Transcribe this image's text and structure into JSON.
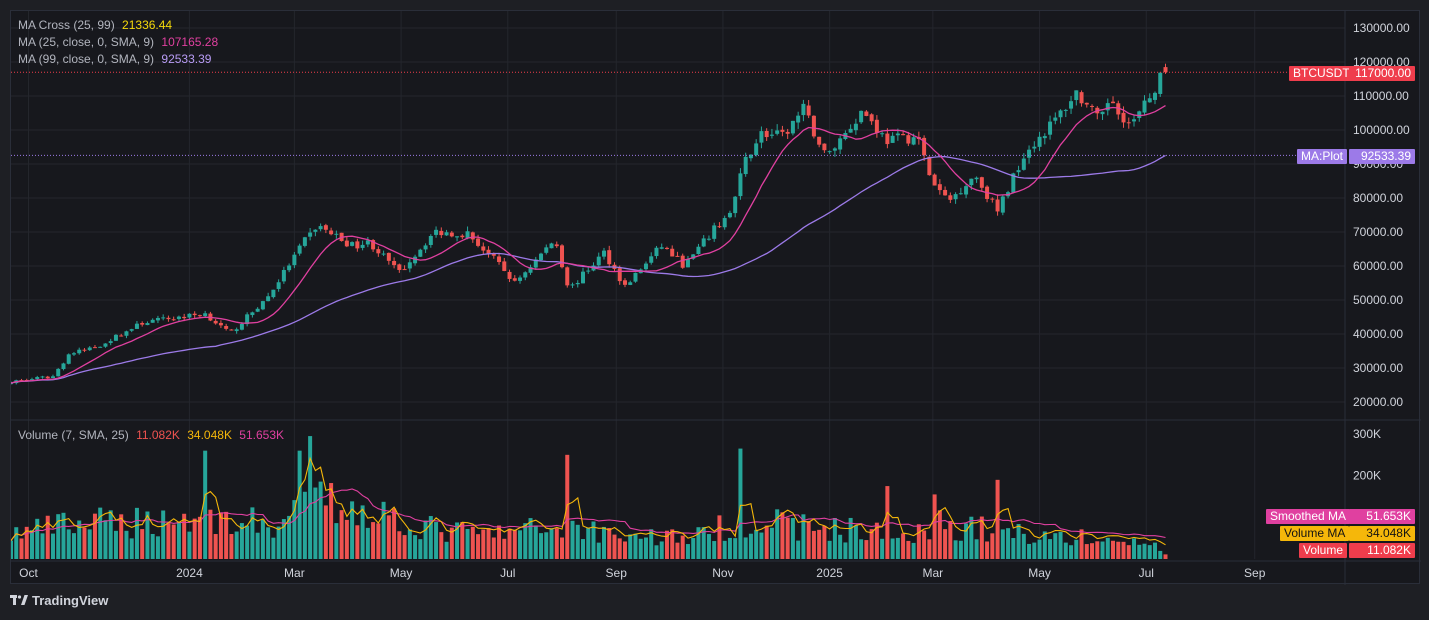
{
  "symbol_label": "BTCUSDT",
  "last_price_label": "117000.00",
  "legend": {
    "ma_cross": {
      "label": "MA Cross (25, 99)",
      "value": "21336.44"
    },
    "ma25": {
      "label": "MA (25, close, 0, SMA, 9)",
      "value": "107165.28"
    },
    "ma99": {
      "label": "MA (99, close, 0, SMA, 9)",
      "value": "92533.39"
    },
    "volume": {
      "label": "Volume (7, SMA, 25)",
      "v1": "11.082K",
      "v2": "34.048K",
      "v3": "51.653K"
    }
  },
  "badges": {
    "ma_plot_label": "MA:Plot",
    "ma_plot_value": "92533.39",
    "smoothed_label": "Smoothed MA",
    "smoothed_value": "51.653K",
    "volume_ma_label": "Volume MA",
    "volume_ma_value": "34.048K",
    "volume_label": "Volume",
    "volume_value": "11.082K"
  },
  "footer": {
    "brand": "TradingView"
  },
  "colors": {
    "up": "#26a69a",
    "down": "#ef5350",
    "ma25": "#e040a0",
    "ma99": "#9c7ae8",
    "vol_ma": "#f5b70a",
    "smoothed": "#e040a0",
    "grid": "#24262d",
    "axis_text": "#d1d4dc"
  },
  "chart_data": {
    "type": "candlestick",
    "price_axis": {
      "ticks": [
        20000,
        30000,
        40000,
        50000,
        60000,
        70000,
        80000,
        90000,
        100000,
        110000,
        120000,
        130000
      ],
      "tick_labels": [
        "20000.00",
        "30000.00",
        "40000.00",
        "50000.00",
        "60000.00",
        "70000.00",
        "80000.00",
        "90000.00",
        "100000.00",
        "110000.00",
        "120000.00",
        "130000.00"
      ],
      "range": [
        15000,
        135000
      ]
    },
    "volume_axis": {
      "ticks": [
        200000,
        300000
      ],
      "tick_labels": [
        "200K",
        "300K"
      ],
      "range": [
        0,
        310000
      ]
    },
    "x_axis": {
      "labels": [
        "Oct",
        "2024",
        "Mar",
        "May",
        "Jul",
        "Sep",
        "Nov",
        "2025",
        "Mar",
        "May",
        "Jul",
        "Sep"
      ],
      "dates": [
        "2023-10-01",
        "2024-01-01",
        "2024-03-01",
        "2024-05-01",
        "2024-07-01",
        "2024-09-01",
        "2024-11-01",
        "2025-01-01",
        "2025-03-01",
        "2025-05-01",
        "2025-07-01",
        "2025-09-01"
      ]
    },
    "price_anchors": [
      [
        "2023-09-21",
        26000
      ],
      [
        "2023-10-15",
        27500
      ],
      [
        "2023-10-24",
        34000
      ],
      [
        "2023-11-10",
        36500
      ],
      [
        "2023-12-06",
        43500
      ],
      [
        "2024-01-10",
        46000
      ],
      [
        "2024-01-24",
        40000
      ],
      [
        "2024-02-15",
        51000
      ],
      [
        "2024-03-05",
        66000
      ],
      [
        "2024-03-14",
        72000
      ],
      [
        "2024-04-03",
        66000
      ],
      [
        "2024-04-13",
        67000
      ],
      [
        "2024-04-30",
        58000
      ],
      [
        "2024-05-20",
        70000
      ],
      [
        "2024-06-08",
        69500
      ],
      [
        "2024-06-25",
        61000
      ],
      [
        "2024-07-05",
        55000
      ],
      [
        "2024-07-28",
        68000
      ],
      [
        "2024-08-05",
        53000
      ],
      [
        "2024-08-25",
        64000
      ],
      [
        "2024-09-06",
        54000
      ],
      [
        "2024-09-27",
        66000
      ],
      [
        "2024-10-10",
        60000
      ],
      [
        "2024-10-29",
        72000
      ],
      [
        "2024-11-06",
        76000
      ],
      [
        "2024-11-13",
        90000
      ],
      [
        "2024-11-22",
        99000
      ],
      [
        "2024-12-05",
        98000
      ],
      [
        "2024-12-17",
        106000
      ],
      [
        "2024-12-30",
        92000
      ],
      [
        "2025-01-20",
        106000
      ],
      [
        "2025-02-02",
        97000
      ],
      [
        "2025-02-20",
        98000
      ],
      [
        "2025-03-01",
        84000
      ],
      [
        "2025-03-10",
        79000
      ],
      [
        "2025-03-25",
        87000
      ],
      [
        "2025-04-07",
        76000
      ],
      [
        "2025-04-22",
        93000
      ],
      [
        "2025-05-10",
        103000
      ],
      [
        "2025-05-22",
        111000
      ],
      [
        "2025-06-05",
        102000
      ],
      [
        "2025-06-10",
        110000
      ],
      [
        "2025-06-22",
        101000
      ],
      [
        "2025-07-02",
        108500
      ],
      [
        "2025-07-11",
        117500
      ],
      [
        "2025-07-14",
        117000
      ]
    ],
    "volume_profile": [
      [
        "2023-09-21",
        60000
      ],
      [
        "2023-10-20",
        80000
      ],
      [
        "2023-12-01",
        90000
      ],
      [
        "2024-01-10",
        100000
      ],
      [
        "2024-02-20",
        80000
      ],
      [
        "2024-03-15",
        140000
      ],
      [
        "2024-04-20",
        110000
      ],
      [
        "2024-05-20",
        70000
      ],
      [
        "2024-06-20",
        60000
      ],
      [
        "2024-08-05",
        80000
      ],
      [
        "2024-09-10",
        55000
      ],
      [
        "2024-10-20",
        55000
      ],
      [
        "2024-11-12",
        95000
      ],
      [
        "2024-12-10",
        80000
      ],
      [
        "2025-01-15",
        70000
      ],
      [
        "2025-02-10",
        55000
      ],
      [
        "2025-03-01",
        85000
      ],
      [
        "2025-04-07",
        70000
      ],
      [
        "2025-05-10",
        55000
      ],
      [
        "2025-06-20",
        40000
      ],
      [
        "2025-07-14",
        30000
      ]
    ],
    "volume_spikes": [
      [
        "2024-01-11",
        260000
      ],
      [
        "2024-03-05",
        260000
      ],
      [
        "2024-03-11",
        295000
      ],
      [
        "2024-08-05",
        250000
      ],
      [
        "2024-11-12",
        265000
      ],
      [
        "2025-02-03",
        175000
      ],
      [
        "2025-03-03",
        155000
      ],
      [
        "2025-04-07",
        190000
      ]
    ],
    "last": {
      "price": 117000,
      "ma25": 107165.28,
      "ma99": 92533.39,
      "volume": 11082,
      "volume_ma": 34048,
      "smoothed_ma": 51653
    }
  }
}
